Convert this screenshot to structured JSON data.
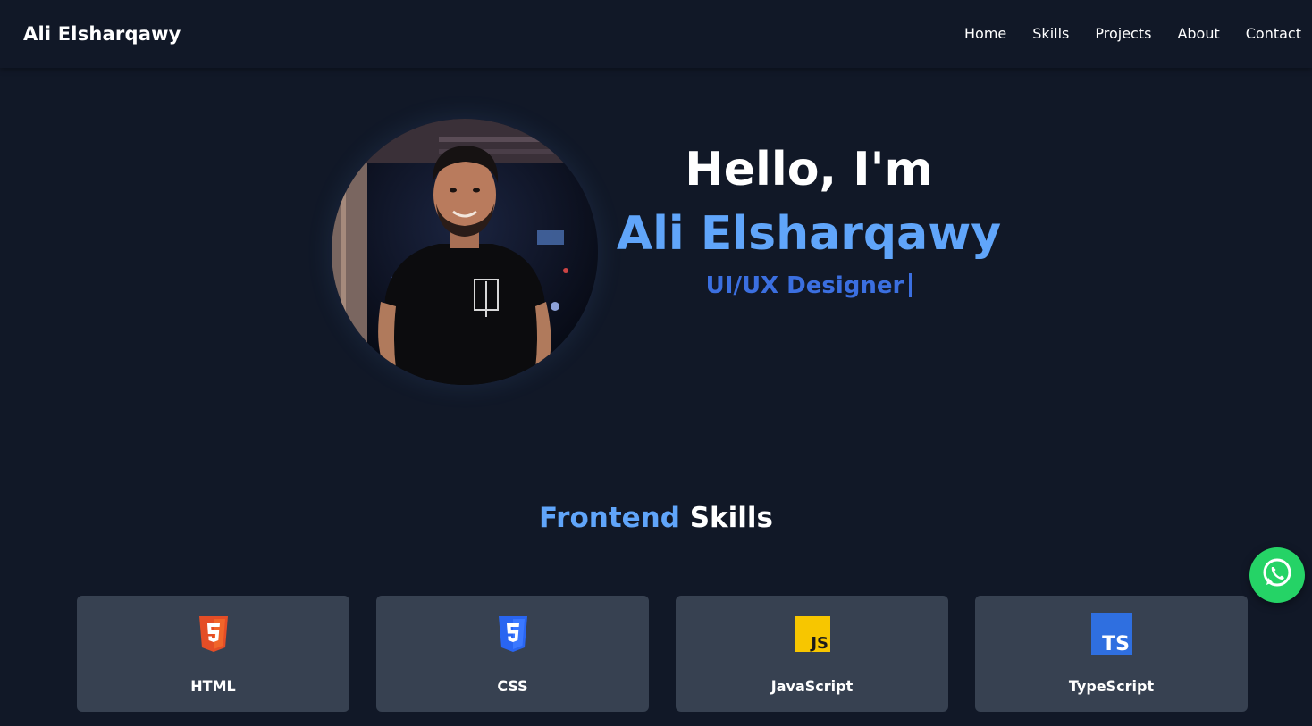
{
  "navbar": {
    "brand": "Ali Elsharqawy",
    "links": [
      "Home",
      "Skills",
      "Projects",
      "About",
      "Contact"
    ]
  },
  "hero": {
    "greeting": "Hello, I'm",
    "name": "Ali Elsharqawy",
    "role": "UI/UX Designer",
    "name_color": "#60a5fa",
    "role_color": "#3b6fe0"
  },
  "skills": {
    "title_accent": "Frontend",
    "title_rest": "Skills",
    "items": [
      {
        "label": "HTML",
        "icon": "html5-icon",
        "color": "#e44d26"
      },
      {
        "label": "CSS",
        "icon": "css3-icon",
        "color": "#2965f1"
      },
      {
        "label": "JavaScript",
        "icon": "javascript-icon",
        "color": "#f7df1e"
      },
      {
        "label": "TypeScript",
        "icon": "typescript-icon",
        "color": "#3178c6"
      }
    ]
  },
  "floating": {
    "whatsapp_icon": "whatsapp-icon",
    "color": "#25d366"
  },
  "theme": {
    "background": "#111827",
    "card": "#374151"
  }
}
